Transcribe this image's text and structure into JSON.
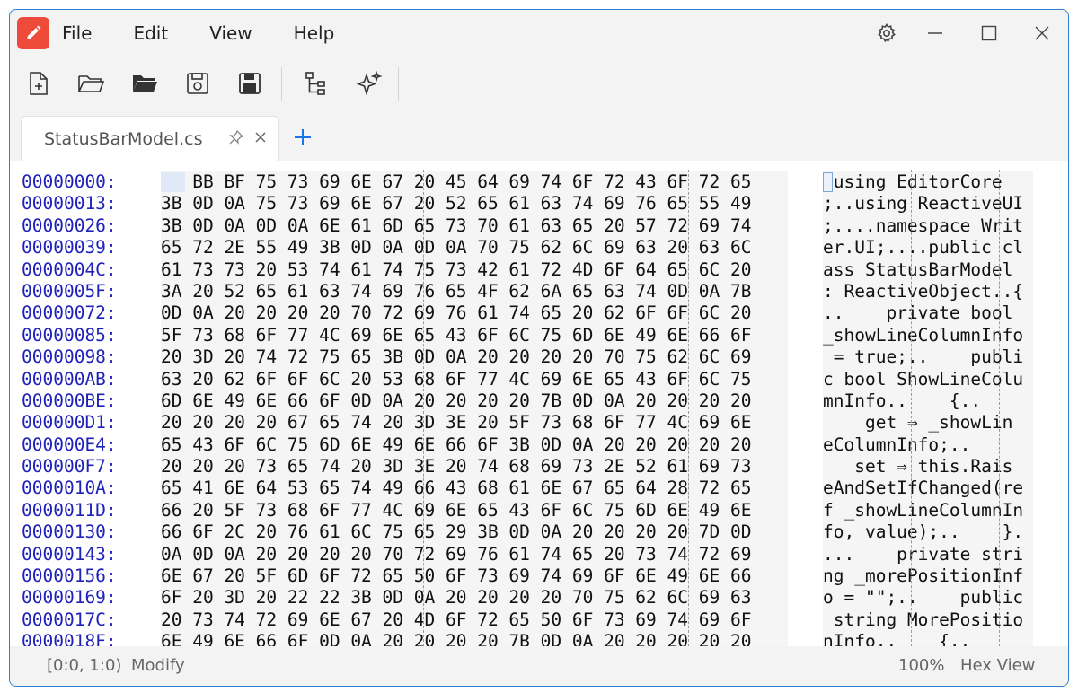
{
  "menu": [
    "File",
    "Edit",
    "View",
    "Help"
  ],
  "toolbar": {
    "buttons": [
      "new-file-icon",
      "open-folder-icon",
      "open-folder-filled-icon",
      "save-icon",
      "save-as-icon",
      "tree-view-icon",
      "sparkle-icon"
    ]
  },
  "tab": {
    "label": "StatusBarModel.cs"
  },
  "offsets": [
    "00000000:",
    "00000013:",
    "00000026:",
    "00000039:",
    "0000004C:",
    "0000005F:",
    "00000072:",
    "00000085:",
    "00000098:",
    "000000AB:",
    "000000BE:",
    "000000D1:",
    "000000E4:",
    "000000F7:",
    "0000010A:",
    "0000011D:",
    "00000130:",
    "00000143:",
    "00000156:",
    "00000169:",
    "0000017C:",
    "0000018F:"
  ],
  "hex_rows": [
    "EF BB BF 75 73 69 6E 67 20 45 64 69 74 6F 72 43 6F 72 65",
    "3B 0D 0A 75 73 69 6E 67 20 52 65 61 63 74 69 76 65 55 49",
    "3B 0D 0A 0D 0A 6E 61 6D 65 73 70 61 63 65 20 57 72 69 74",
    "65 72 2E 55 49 3B 0D 0A 0D 0A 70 75 62 6C 69 63 20 63 6C",
    "61 73 73 20 53 74 61 74 75 73 42 61 72 4D 6F 64 65 6C 20",
    "3A 20 52 65 61 63 74 69 76 65 4F 62 6A 65 63 74 0D 0A 7B",
    "0D 0A 20 20 20 20 70 72 69 76 61 74 65 20 62 6F 6F 6C 20",
    "5F 73 68 6F 77 4C 69 6E 65 43 6F 6C 75 6D 6E 49 6E 66 6F",
    "20 3D 20 74 72 75 65 3B 0D 0A 20 20 20 20 70 75 62 6C 69",
    "63 20 62 6F 6F 6C 20 53 68 6F 77 4C 69 6E 65 43 6F 6C 75",
    "6D 6E 49 6E 66 6F 0D 0A 20 20 20 20 7B 0D 0A 20 20 20 20",
    "20 20 20 20 67 65 74 20 3D 3E 20 5F 73 68 6F 77 4C 69 6E",
    "65 43 6F 6C 75 6D 6E 49 6E 66 6F 3B 0D 0A 20 20 20 20 20",
    "20 20 20 73 65 74 20 3D 3E 20 74 68 69 73 2E 52 61 69 73",
    "65 41 6E 64 53 65 74 49 66 43 68 61 6E 67 65 64 28 72 65",
    "66 20 5F 73 68 6F 77 4C 69 6E 65 43 6F 6C 75 6D 6E 49 6E",
    "66 6F 2C 20 76 61 6C 75 65 29 3B 0D 0A 20 20 20 20 7D 0D",
    "0A 0D 0A 20 20 20 20 70 72 69 76 61 74 65 20 73 74 72 69",
    "6E 67 20 5F 6D 6F 72 65 50 6F 73 69 74 69 6F 6E 49 6E 66",
    "6F 20 3D 20 22 22 3B 0D 0A 20 20 20 20 70 75 62 6C 69 63",
    "20 73 74 72 69 6E 67 20 4D 6F 72 65 50 6F 73 69 74 69 6F",
    "6E 49 6E 66 6F 0D 0A 20 20 20 20 7B 0D 0A 20 20 20 20 20"
  ],
  "ascii_rows": [
    "…using EditorCore",
    ";..using ReactiveUI",
    ";....namespace Writ",
    "er.UI;....public cl",
    "ass StatusBarModel ",
    ": ReactiveObject..{",
    "..    private bool ",
    "_showLineColumnInfo",
    " = true;..    publi",
    "c bool ShowLineColu",
    "mnInfo..    {..    ",
    "    get ⇒ _showLin",
    "eColumnInfo;..     ",
    "   set ⇒ this.Rais",
    "eAndSetIfChanged(re",
    "f _showLineColumnIn",
    "fo, value);..    }.",
    "...    private stri",
    "ng _morePositionInf",
    "o = \"\";..    public",
    " string MorePositio",
    "nInfo..    {..     "
  ],
  "status": {
    "position": "[0:0, 1:0)",
    "mode": "Modify",
    "zoom": "100%",
    "view": "Hex View"
  },
  "colors": {
    "accent": "#2f7fd0",
    "app_icon": "#ee4b3b",
    "offset_text": "#1f22b8",
    "add_tab": "#1a73e8"
  }
}
